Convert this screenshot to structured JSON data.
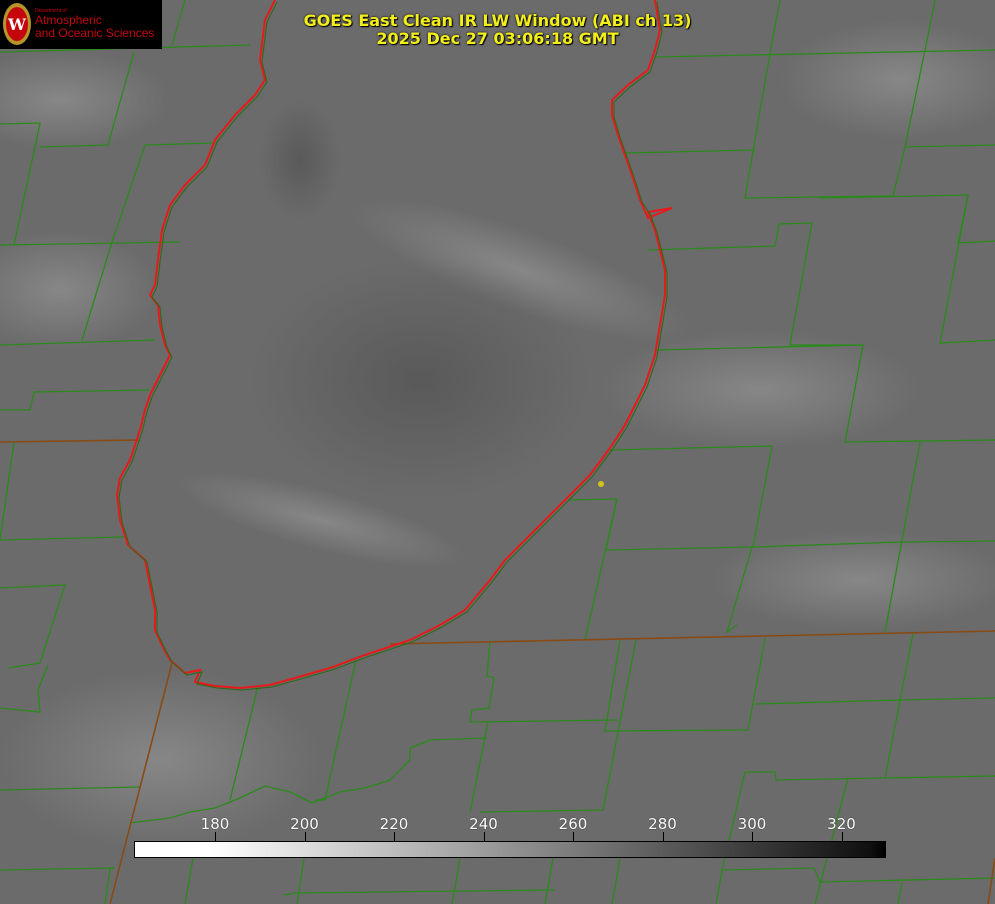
{
  "title": {
    "line1": "GOES East Clean IR LW Window (ABI ch 13)",
    "line2": "2025 Dec 27 03:06:18 GMT"
  },
  "logo": {
    "line_small": "Department of",
    "line1": "Atmospheric",
    "line2": "and Oceanic Sciences",
    "seal_letter": "W"
  },
  "colorbar": {
    "ticks": [
      "180",
      "200",
      "220",
      "240",
      "260",
      "280",
      "300",
      "320"
    ],
    "colors": {
      "low": "#ffffff",
      "high": "#000000"
    }
  },
  "colors": {
    "county_lines": "#2a8a1a",
    "lake_outline": "#e8191a",
    "title_text": "#f2ee1a",
    "marker": "#d4c41a"
  }
}
